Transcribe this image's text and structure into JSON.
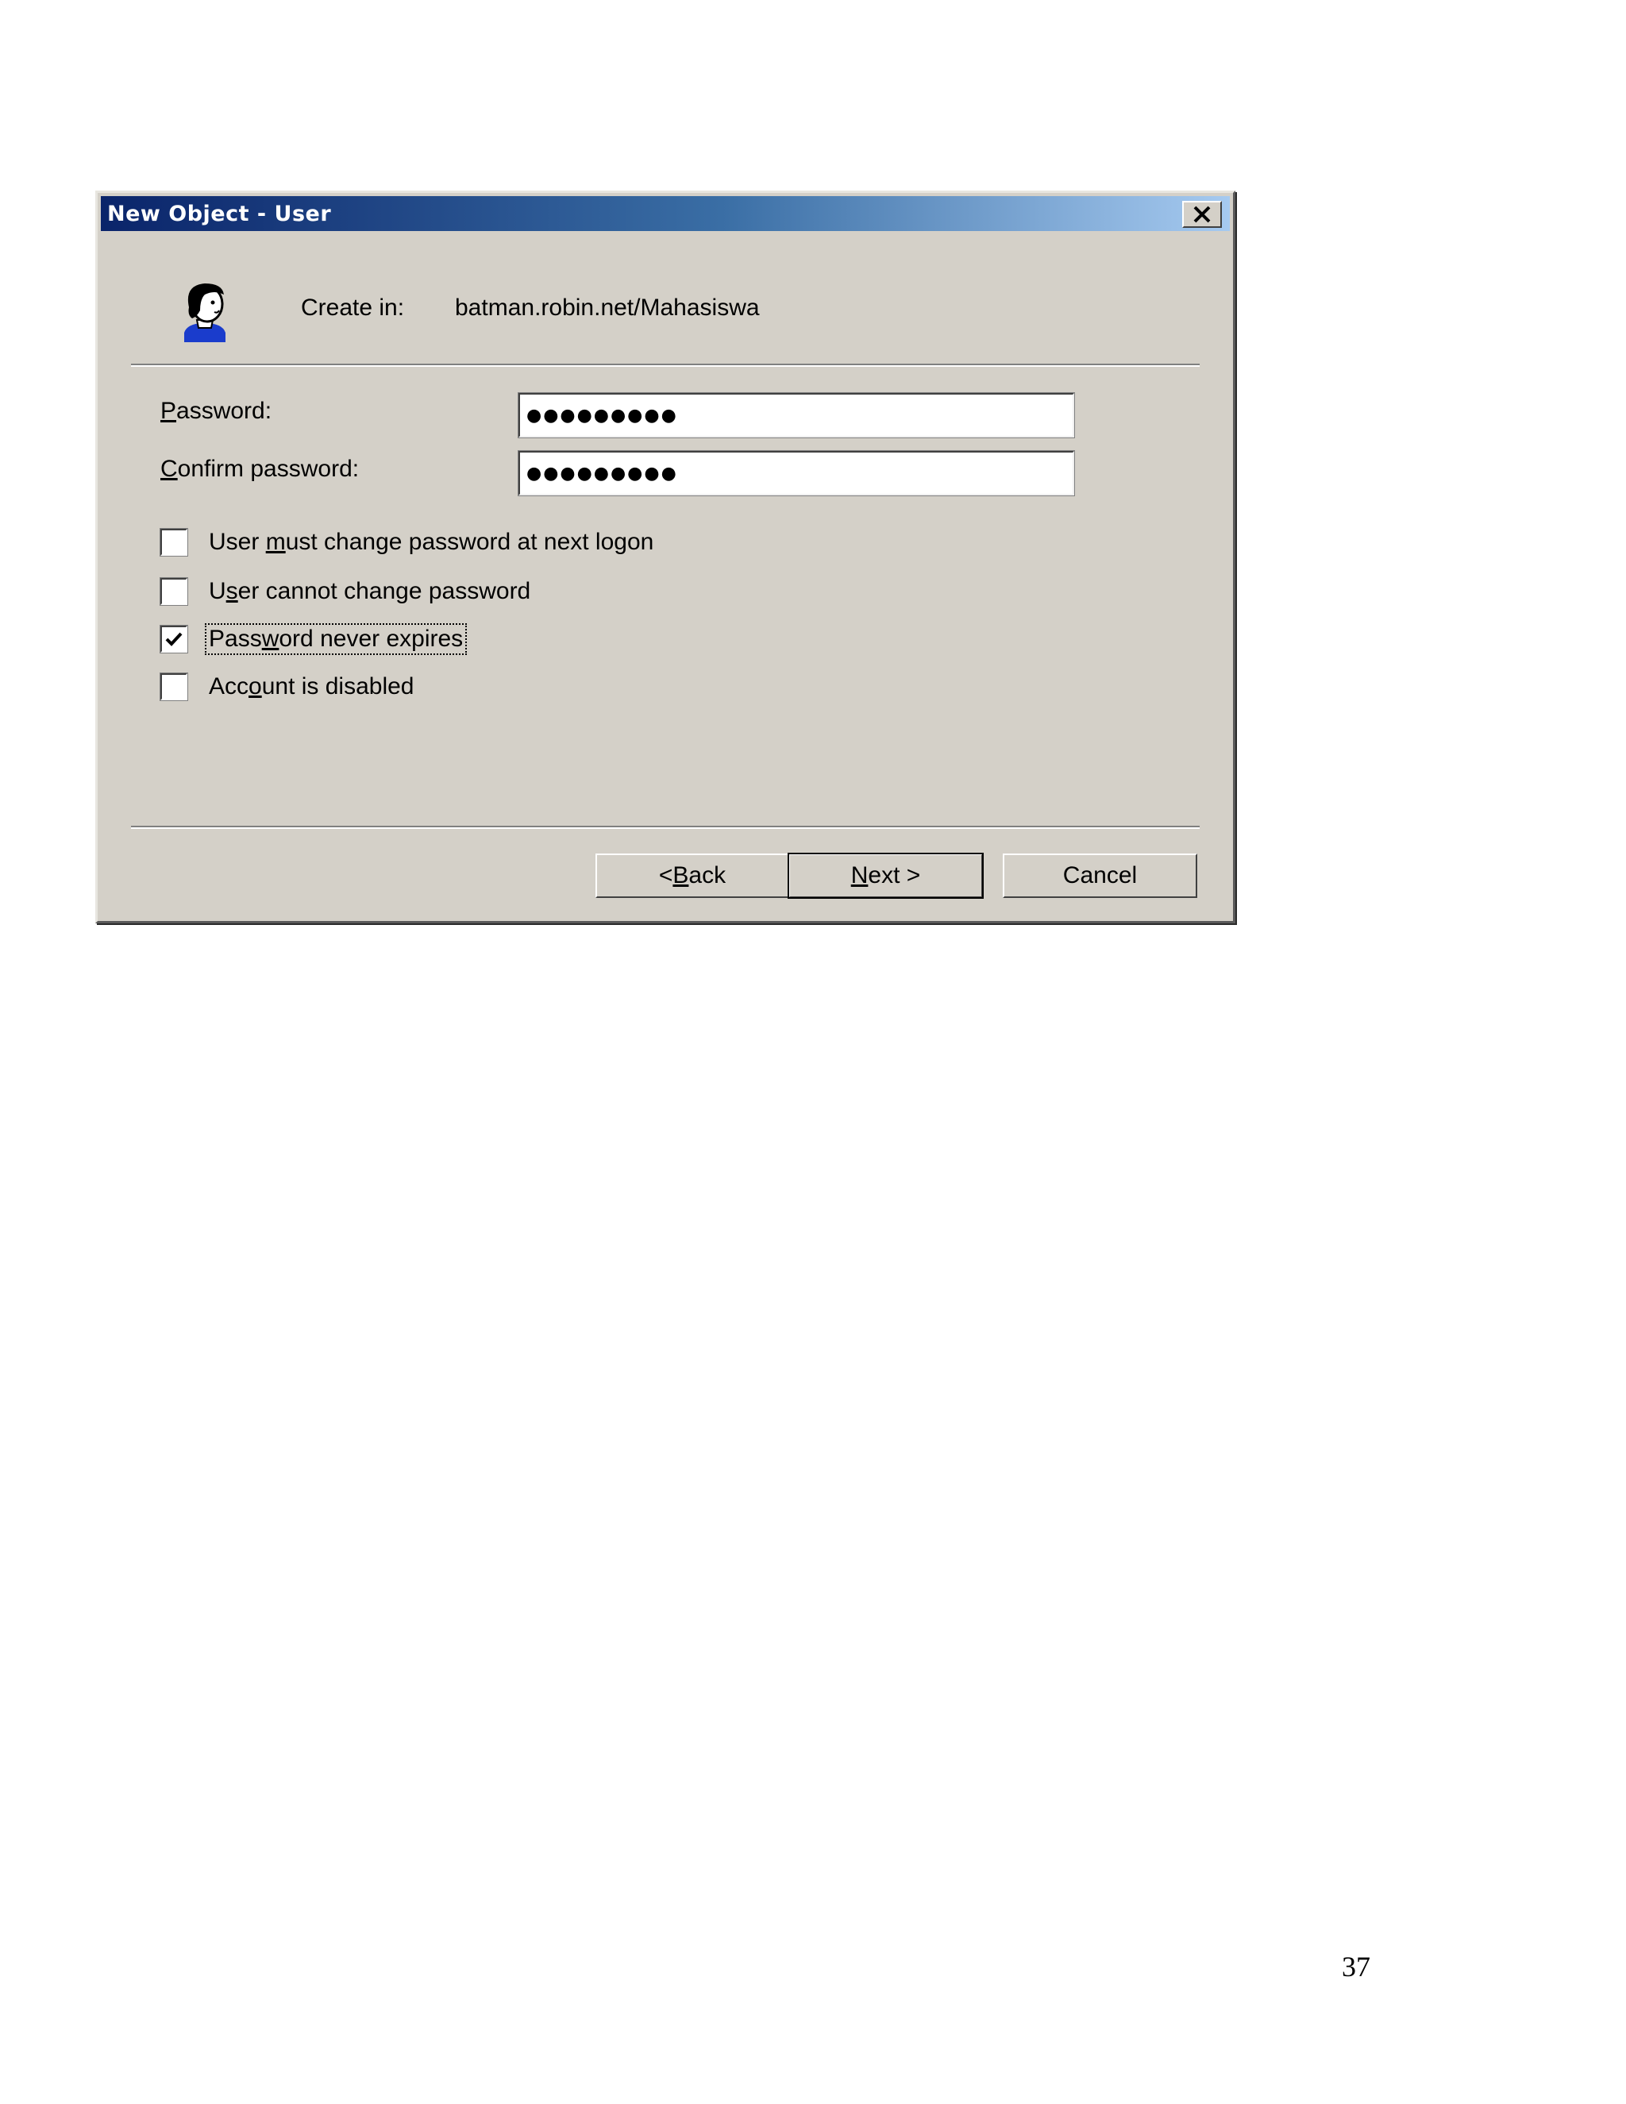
{
  "dialog": {
    "title": "New Object - User",
    "create_in_label": "Create in:",
    "create_in_path": "batman.robin.net/Mahasiswa",
    "icons": {
      "close": "close-icon",
      "user": "user-icon"
    }
  },
  "fields": {
    "password_label_ul": "P",
    "password_label_rest": "assword:",
    "password_value": "●●●●●●●●●",
    "confirm_label_ul": "C",
    "confirm_label_rest": "onfirm password:",
    "confirm_value": "●●●●●●●●●"
  },
  "options": [
    {
      "pre": "User ",
      "ul": "m",
      "post": "ust change password at next logon",
      "checked": false
    },
    {
      "pre": "U",
      "ul": "s",
      "post": "er cannot change password",
      "checked": false
    },
    {
      "pre": "Pass",
      "ul": "w",
      "post": "ord never expires",
      "checked": true
    },
    {
      "pre": "Acc",
      "ul": "o",
      "post": "unt is disabled",
      "checked": false
    }
  ],
  "buttons": {
    "back_pre": "< ",
    "back_ul": "B",
    "back_post": "ack",
    "next_ul": "N",
    "next_post": "ext >",
    "cancel": "Cancel"
  },
  "page_number": "37"
}
